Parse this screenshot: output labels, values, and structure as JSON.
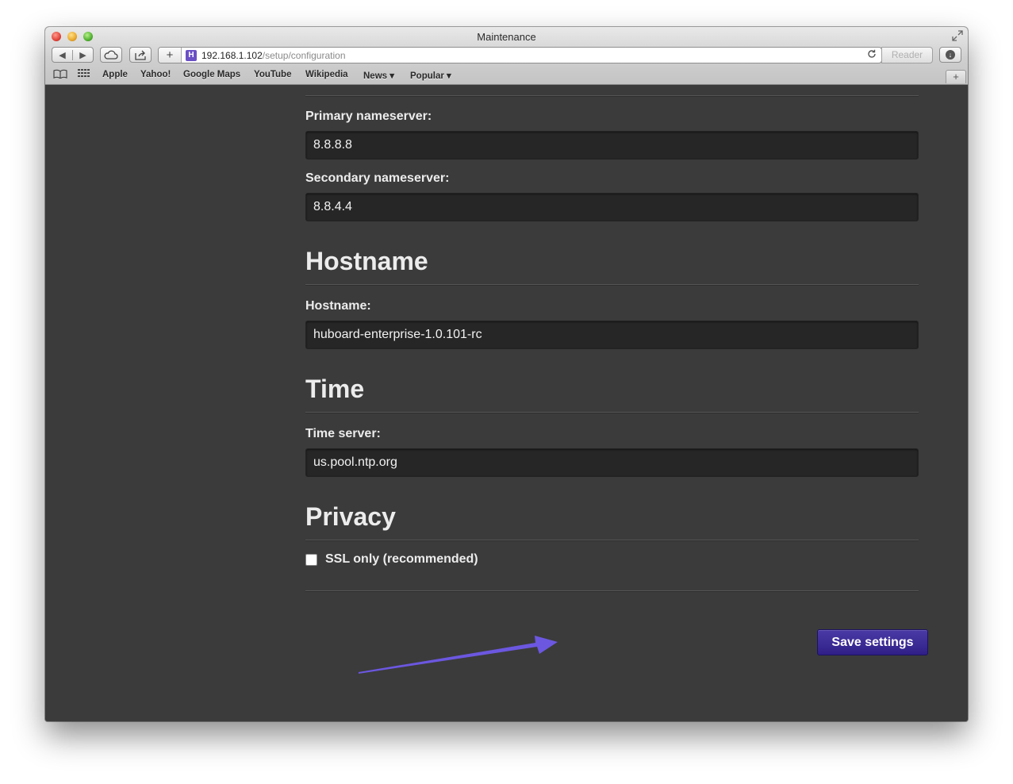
{
  "window": {
    "title": "Maintenance"
  },
  "toolbar": {
    "back_glyph": "◀",
    "forward_glyph": "▶",
    "new_tab_glyph": "+",
    "favicon_letter": "H",
    "url_host": "192.168.1.102",
    "url_path": "/setup/configuration",
    "reader_label": "Reader"
  },
  "bookmarks": {
    "items": [
      "Apple",
      "Yahoo!",
      "Google Maps",
      "YouTube",
      "Wikipedia",
      "News ▾",
      "Popular ▾"
    ]
  },
  "network": {
    "primary_label": "Primary nameserver:",
    "primary_value": "8.8.8.8",
    "secondary_label": "Secondary nameserver:",
    "secondary_value": "8.8.4.4"
  },
  "hostname": {
    "title": "Hostname",
    "label": "Hostname:",
    "value": "huboard-enterprise-1.0.101-rc"
  },
  "time": {
    "title": "Time",
    "label": "Time server:",
    "value": "us.pool.ntp.org"
  },
  "privacy": {
    "title": "Privacy",
    "ssl_label": "SSL only (recommended)",
    "ssl_checked": false
  },
  "actions": {
    "save_label": "Save settings"
  },
  "colors": {
    "accent": "#3a2a96",
    "arrow": "#6b57e0",
    "background": "#3b3b3b",
    "input_bg": "#262626"
  }
}
